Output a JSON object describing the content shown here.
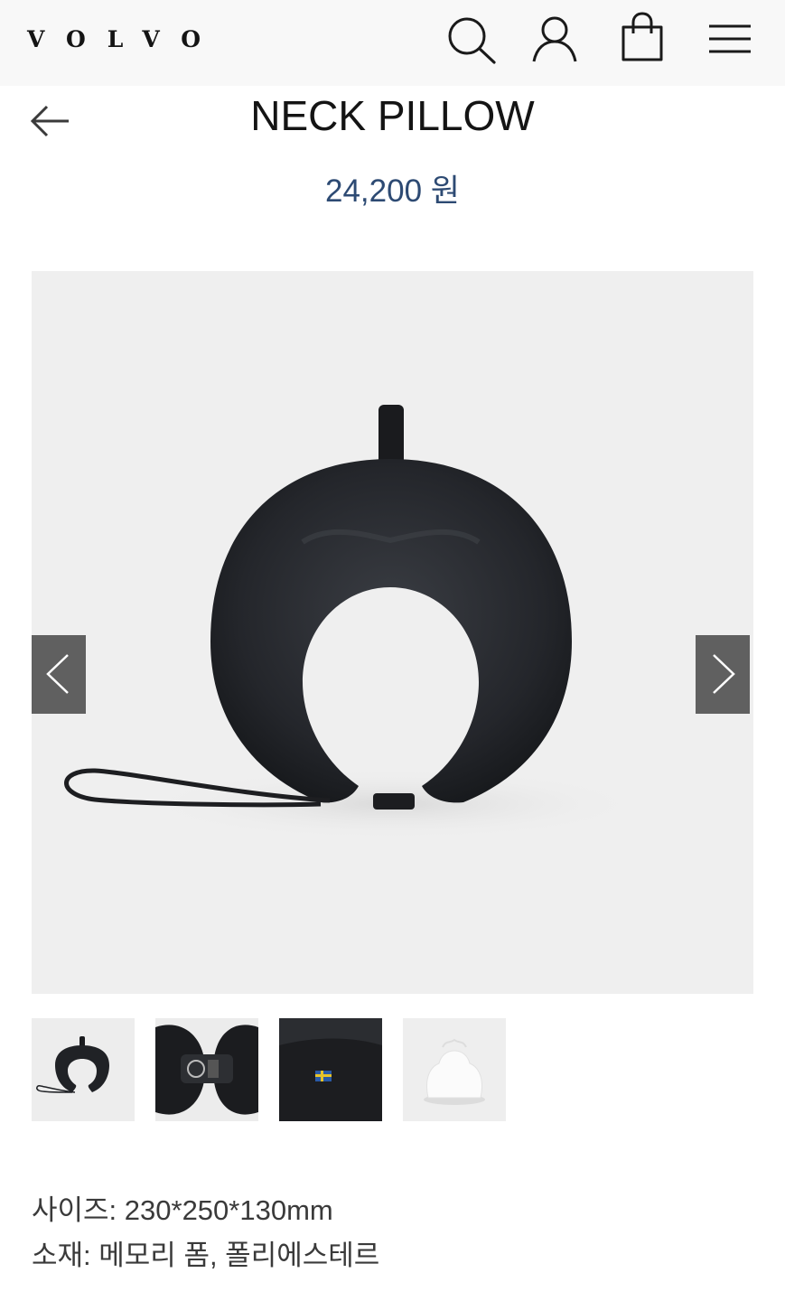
{
  "header": {
    "logo_text": "VOLVO",
    "icons": [
      "search-icon",
      "account-icon",
      "shopping-bag-icon",
      "menu-icon"
    ]
  },
  "product": {
    "title": "NECK PILLOW",
    "price": "24,200 원",
    "image_count": 4,
    "active_image_index": 0
  },
  "specs": {
    "size": "사이즈: 230*250*130mm",
    "material": "소재: 메모리 폼, 폴리에스테르"
  },
  "colors": {
    "header_bg": "#f8f8f8",
    "price": "#2d4a73",
    "image_bg": "#efefef",
    "arrow_bg": "#464646"
  }
}
